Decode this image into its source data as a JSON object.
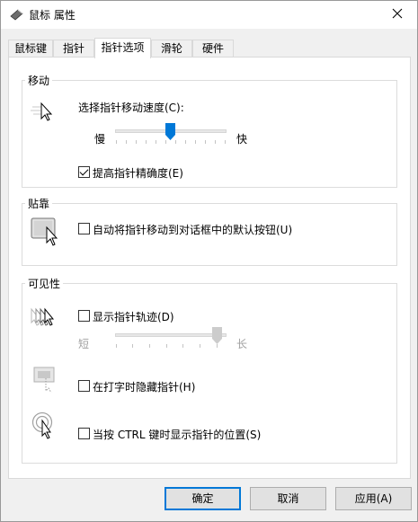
{
  "window": {
    "title": "鼠标 属性",
    "icon": "mouse-icon",
    "close": "close-icon"
  },
  "tabs": [
    {
      "label": "鼠标键",
      "active": false
    },
    {
      "label": "指针",
      "active": false
    },
    {
      "label": "指针选项",
      "active": true
    },
    {
      "label": "滑轮",
      "active": false
    },
    {
      "label": "硬件",
      "active": false
    }
  ],
  "motion": {
    "group_label": "移动",
    "speed_label": "选择指针移动速度(C):",
    "slow_label": "慢",
    "fast_label": "快",
    "speed_level": 0.5,
    "precision_label": "提高指针精确度(E)",
    "precision_checked": true
  },
  "snap": {
    "group_label": "贴靠",
    "snap_label": "自动将指针移动到对话框中的默认按钮(U)",
    "snap_checked": false
  },
  "visibility": {
    "group_label": "可见性",
    "trails_label": "显示指针轨迹(D)",
    "trails_checked": false,
    "short_label": "短",
    "long_label": "长",
    "trail_level": 1.0,
    "hide_label": "在打字时隐藏指针(H)",
    "hide_checked": false,
    "ctrl_label": "当按 CTRL 键时显示指针的位置(S)",
    "ctrl_checked": false
  },
  "buttons": {
    "ok": "确定",
    "cancel": "取消",
    "apply": "应用(A)"
  },
  "colors": {
    "accent": "#0078d7"
  }
}
